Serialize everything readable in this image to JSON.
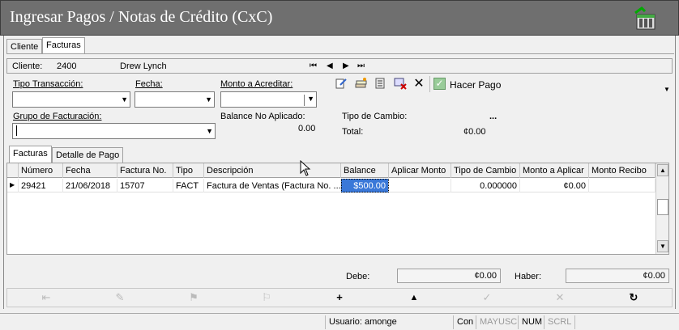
{
  "window": {
    "title": "Ingresar Pagos / Notas de Crédito (CxC)",
    "icon": "store-icon"
  },
  "main_tabs": [
    {
      "label": "Cliente"
    },
    {
      "label": "Facturas"
    }
  ],
  "customer_bar": {
    "label": "Cliente:",
    "code": "2400",
    "name": "Drew Lynch",
    "nav": {
      "first": "⏮",
      "prev": "◀",
      "next": "▶",
      "last": "⏭"
    }
  },
  "form": {
    "tipo_transaccion": {
      "label": "Tipo Transacción:",
      "value": ""
    },
    "fecha": {
      "label": "Fecha:",
      "value": ""
    },
    "monto_acreditar": {
      "label": "Monto a Acreditar:",
      "value": ""
    },
    "grupo_facturacion": {
      "label": "Grupo de Facturación:",
      "value": ""
    },
    "balance_no_aplicado": {
      "label": "Balance No Aplicado:",
      "value": "0.00"
    },
    "tipo_cambio": {
      "label": "Tipo de Cambio:",
      "value": "..."
    },
    "total": {
      "label": "Total:",
      "value": "¢0.00"
    },
    "hacer_pago": {
      "label": "Hacer Pago"
    }
  },
  "toolbar_icons": [
    "edit-icon",
    "stack-icon",
    "list-icon",
    "delete-grid-icon",
    "close-icon"
  ],
  "sub_tabs": [
    {
      "label": "Facturas"
    },
    {
      "label": "Detalle de Pago"
    }
  ],
  "grid": {
    "columns": [
      "Número",
      "Fecha",
      "Factura No.",
      "Tipo",
      "Descripción",
      "Balance",
      "Aplicar Monto",
      "Tipo de Cambio",
      "Monto a Aplicar",
      "Monto Recibo"
    ],
    "rows": [
      {
        "numero": "29421",
        "fecha": "21/06/2018",
        "factura": "15707",
        "tipo": "FACT",
        "descripcion": "Factura de Ventas (Factura No. ...",
        "balance": "$500.00",
        "aplicar": "",
        "tipo_cambio": "0.000000",
        "monto_aplicar": "¢0.00",
        "monto_recibo": ""
      }
    ]
  },
  "totals": {
    "debe_label": "Debe:",
    "debe_value": "¢0.00",
    "haber_label": "Haber:",
    "haber_value": "¢0.00"
  },
  "bottom_toolbar": [
    {
      "name": "first-record-button",
      "glyph": "⇤",
      "enabled": false
    },
    {
      "name": "edit-record-button",
      "glyph": "✎",
      "enabled": false
    },
    {
      "name": "flag-button",
      "glyph": "⚑",
      "enabled": false
    },
    {
      "name": "flag-alt-button",
      "glyph": "⚐",
      "enabled": false
    },
    {
      "name": "add-button",
      "glyph": "+",
      "enabled": true
    },
    {
      "name": "up-button",
      "glyph": "▲",
      "enabled": true
    },
    {
      "name": "check-button",
      "glyph": "✓",
      "enabled": false
    },
    {
      "name": "cancel-button",
      "glyph": "✕",
      "enabled": false
    },
    {
      "name": "refresh-button",
      "glyph": "↻",
      "enabled": true
    }
  ],
  "statusbar": {
    "user": "Usuario: amonge",
    "con": "Con",
    "mayusc": "MAYUSC",
    "num": "NUM",
    "scrl": "SCRL"
  }
}
